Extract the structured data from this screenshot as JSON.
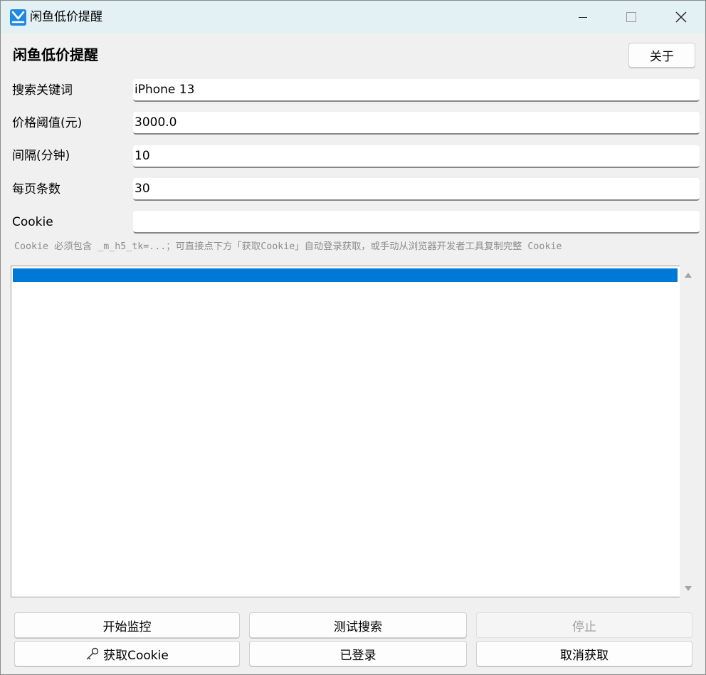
{
  "window": {
    "title": "闲鱼低价提醒"
  },
  "header": {
    "heading": "闲鱼低价提醒",
    "about_button": "关于"
  },
  "form": {
    "keyword_label": "搜索关键词",
    "keyword_value": "iPhone 13",
    "price_label": "价格阈值(元)",
    "price_value": "3000.0",
    "interval_label": "间隔(分钟)",
    "interval_value": "10",
    "page_size_label": "每页条数",
    "page_size_value": "30",
    "cookie_label": "Cookie",
    "cookie_value": "",
    "hint": "Cookie 必须包含 _m_h5_tk=...；可直接点下方「获取Cookie」自动登录获取，或手动从浏览器开发者工具复制完整 Cookie"
  },
  "buttons": {
    "start_monitor": "开始监控",
    "test_search": "测试搜索",
    "stop": "停止",
    "get_cookie": "获取Cookie",
    "logged_in": "已登录",
    "cancel_get": "取消获取"
  },
  "icons": {
    "app": "xianyu-app-icon",
    "get_cookie": "key-icon"
  },
  "colors": {
    "titlebar": "#e3f1f4",
    "selection": "#0078d7",
    "hint_text": "#8c8c8c"
  }
}
